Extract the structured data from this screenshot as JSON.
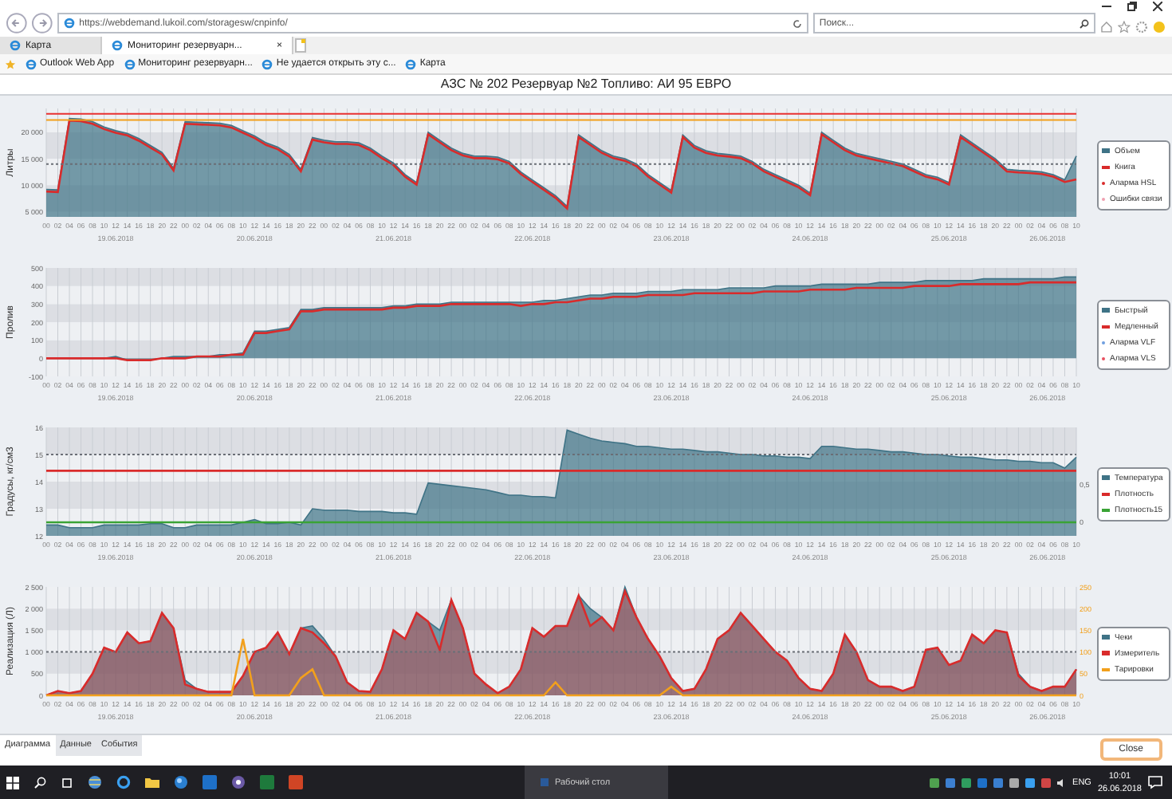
{
  "browser": {
    "address": "https://webdemand.lukoil.com/storagesw/cnpinfo/",
    "search_placeholder": "Поиск...",
    "tabs": [
      {
        "label": "Карта",
        "selected": false
      },
      {
        "label": "Мониторинг резервуарн...",
        "selected": true,
        "close": "×"
      }
    ],
    "favorites": [
      {
        "label": "Outlook Web App"
      },
      {
        "label": "Мониторинг резервуарн..."
      },
      {
        "label": "Не удается открыть эту с..."
      },
      {
        "label": "Карта"
      }
    ]
  },
  "page_title": "АЗС № 202 Резервуар №2 Топливо: АИ 95 ЕВРО",
  "charts": [
    {
      "date_labels": [
        "19.06.2018",
        "20.06.2018",
        "21.06.2018",
        "22.06.2018",
        "23.06.2018",
        "24.06.2018",
        "25.06.2018",
        "26.06.2018"
      ],
      "legend_markers": [
        {
          "label": "Аларма HSL",
          "color": "#d92b2b"
        },
        {
          "label": "Ошибки связи",
          "color": "#f0a0b0"
        }
      ],
      "chart_data": {
        "type": "area",
        "ylabel": "Литры",
        "grid": true,
        "legend": "right",
        "categories": [
          "00",
          "02",
          "04",
          "06",
          "08",
          "10",
          "12",
          "14",
          "16",
          "18",
          "20",
          "22",
          "00",
          "02",
          "04",
          "06",
          "08",
          "10",
          "12",
          "14",
          "16",
          "18",
          "20",
          "22",
          "00",
          "02",
          "04",
          "06",
          "08",
          "10",
          "12",
          "14",
          "16",
          "18",
          "20",
          "22",
          "00",
          "02",
          "04",
          "06",
          "08",
          "10",
          "12",
          "14",
          "16",
          "18",
          "20",
          "22",
          "00",
          "02",
          "04",
          "06",
          "08",
          "10",
          "12",
          "14",
          "16",
          "18",
          "20",
          "22",
          "00",
          "02",
          "04",
          "06",
          "08",
          "10",
          "12",
          "14",
          "16",
          "18",
          "20",
          "22",
          "00",
          "02",
          "04",
          "06",
          "08",
          "10",
          "12",
          "14",
          "16",
          "18",
          "20",
          "22",
          "00",
          "02",
          "04",
          "06",
          "08",
          "10"
        ],
        "ylim": [
          4000,
          24500
        ],
        "yticks": [
          {
            "value": 5000,
            "label": "5 000"
          },
          {
            "value": 10000,
            "label": "10 000"
          },
          {
            "value": 15000,
            "label": "15 000"
          },
          {
            "value": 20000,
            "label": "20 000"
          }
        ],
        "series": [
          {
            "name": "Объем",
            "color": "#3f7386",
            "type": "area",
            "values": [
              9200,
              9100,
              22600,
              22500,
              22000,
              21000,
              20300,
              19800,
              18800,
              17500,
              16200,
              13200,
              22000,
              21900,
              21800,
              21700,
              21300,
              20300,
              19300,
              18000,
              17200,
              15800,
              13000,
              19000,
              18500,
              18200,
              18200,
              18000,
              17000,
              15500,
              14200,
              12000,
              10500,
              20000,
              18500,
              17000,
              16000,
              15500,
              15500,
              15300,
              14500,
              12500,
              11000,
              9500,
              8000,
              6000,
              19500,
              18000,
              16500,
              15500,
              15000,
              14000,
              12000,
              10500,
              9000,
              19500,
              17500,
              16500,
              16000,
              15800,
              15500,
              14500,
              13000,
              12000,
              11000,
              10000,
              8500,
              20000,
              18500,
              17000,
              16000,
              15500,
              15000,
              14500,
              14000,
              13000,
              12000,
              11500,
              10500,
              19500,
              18000,
              16500,
              15000,
              13000,
              12800,
              12700,
              12500,
              12000,
              11000,
              15500
            ]
          },
          {
            "name": "Книга",
            "color": "#d92b2b",
            "type": "line",
            "values": [
              8800,
              8700,
              22200,
              22100,
              21600,
              20600,
              19900,
              19400,
              18400,
              17100,
              15800,
              12800,
              21600,
              21500,
              21400,
              21300,
              20900,
              19900,
              18900,
              17600,
              16800,
              15400,
              12600,
              18600,
              18100,
              17800,
              17800,
              17600,
              16600,
              15100,
              13800,
              11600,
              10100,
              19600,
              18100,
              16600,
              15600,
              15100,
              15100,
              14900,
              14100,
              12100,
              10600,
              9100,
              7600,
              5600,
              19100,
              17600,
              16100,
              15100,
              14600,
              13600,
              11600,
              10100,
              8600,
              19100,
              17100,
              16100,
              15600,
              15400,
              15100,
              14100,
              12600,
              11600,
              10600,
              9600,
              8100,
              19600,
              18100,
              16600,
              15600,
              15100,
              14600,
              14100,
              13600,
              12600,
              11600,
              11100,
              10100,
              19100,
              17600,
              16100,
              14600,
              12600,
              12400,
              12300,
              12100,
              11600,
              10600,
              11100
            ]
          }
        ],
        "ref_lines": [
          {
            "axis": "y",
            "value": 23500,
            "color": "#e83030"
          },
          {
            "axis": "y",
            "value": 22300,
            "color": "#f2a01c"
          },
          {
            "axis": "y",
            "value": 14000
          }
        ]
      }
    },
    {
      "date_labels": [
        "19.06.2018",
        "20.06.2018",
        "21.06.2018",
        "22.06.2018",
        "23.06.2018",
        "24.06.2018",
        "25.06.2018",
        "26.06.2018"
      ],
      "legend_markers": [
        {
          "label": "Аларма VLF",
          "color": "#6f9fe0"
        },
        {
          "label": "Аларма VLS",
          "color": "#e85060"
        }
      ],
      "chart_data": {
        "type": "area",
        "ylabel": "Пролив",
        "grid": true,
        "legend": "right",
        "categories": [
          "00",
          "02",
          "04",
          "06",
          "08",
          "10",
          "12",
          "14",
          "16",
          "18",
          "20",
          "22",
          "00",
          "02",
          "04",
          "06",
          "08",
          "10",
          "12",
          "14",
          "16",
          "18",
          "20",
          "22",
          "00",
          "02",
          "04",
          "06",
          "08",
          "10",
          "12",
          "14",
          "16",
          "18",
          "20",
          "22",
          "00",
          "02",
          "04",
          "06",
          "08",
          "10",
          "12",
          "14",
          "16",
          "18",
          "20",
          "22",
          "00",
          "02",
          "04",
          "06",
          "08",
          "10",
          "12",
          "14",
          "16",
          "18",
          "20",
          "22",
          "00",
          "02",
          "04",
          "06",
          "08",
          "10",
          "12",
          "14",
          "16",
          "18",
          "20",
          "22",
          "00",
          "02",
          "04",
          "06",
          "08",
          "10",
          "12",
          "14",
          "16",
          "18",
          "20",
          "22",
          "00",
          "02",
          "04",
          "06",
          "08",
          "10"
        ],
        "ylim": [
          -100,
          500
        ],
        "yticks": [
          {
            "value": -100,
            "label": "-100"
          },
          {
            "value": 0,
            "label": "0"
          },
          {
            "value": 100,
            "label": "100"
          },
          {
            "value": 200,
            "label": "200"
          },
          {
            "value": 300,
            "label": "300"
          },
          {
            "value": 400,
            "label": "400"
          },
          {
            "value": 500,
            "label": "500"
          }
        ],
        "series": [
          {
            "name": "Быстрый",
            "color": "#3f7386",
            "type": "area",
            "values": [
              0,
              0,
              0,
              0,
              0,
              0,
              10,
              -10,
              -10,
              -10,
              0,
              10,
              10,
              10,
              10,
              20,
              20,
              30,
              150,
              150,
              160,
              170,
              270,
              270,
              280,
              280,
              280,
              280,
              280,
              280,
              290,
              290,
              300,
              300,
              300,
              310,
              310,
              310,
              310,
              310,
              310,
              310,
              310,
              320,
              320,
              330,
              340,
              350,
              350,
              360,
              360,
              360,
              370,
              370,
              370,
              380,
              380,
              380,
              380,
              390,
              390,
              390,
              390,
              400,
              400,
              400,
              400,
              410,
              410,
              410,
              410,
              410,
              420,
              420,
              420,
              420,
              430,
              430,
              430,
              430,
              430,
              440,
              440,
              440,
              440,
              440,
              440,
              440,
              450,
              450
            ]
          },
          {
            "name": "Медленный",
            "color": "#d92b2b",
            "type": "line",
            "values": [
              0,
              0,
              0,
              0,
              0,
              0,
              0,
              -10,
              -10,
              -10,
              0,
              0,
              0,
              10,
              10,
              10,
              20,
              20,
              140,
              140,
              150,
              160,
              260,
              260,
              270,
              270,
              270,
              270,
              270,
              270,
              280,
              280,
              290,
              290,
              290,
              300,
              300,
              300,
              300,
              300,
              300,
              290,
              300,
              300,
              310,
              310,
              320,
              330,
              330,
              340,
              340,
              340,
              350,
              350,
              350,
              350,
              360,
              360,
              360,
              360,
              360,
              360,
              370,
              370,
              370,
              370,
              380,
              380,
              380,
              380,
              390,
              390,
              390,
              390,
              390,
              400,
              400,
              400,
              400,
              410,
              410,
              410,
              410,
              410,
              410,
              420,
              420,
              420,
              420,
              420
            ]
          }
        ]
      }
    },
    {
      "date_labels": [
        "19.06.2018",
        "20.06.2018",
        "21.06.2018",
        "22.06.2018",
        "23.06.2018",
        "24.06.2018",
        "25.06.2018",
        "26.06.2018"
      ],
      "chart_data": {
        "type": "area",
        "ylabel": "Градусы, кг/см3",
        "grid": true,
        "legend": "right",
        "categories": [
          "00",
          "02",
          "04",
          "06",
          "08",
          "10",
          "12",
          "14",
          "16",
          "18",
          "20",
          "22",
          "00",
          "02",
          "04",
          "06",
          "08",
          "10",
          "12",
          "14",
          "16",
          "18",
          "20",
          "22",
          "00",
          "02",
          "04",
          "06",
          "08",
          "10",
          "12",
          "14",
          "16",
          "18",
          "20",
          "22",
          "00",
          "02",
          "04",
          "06",
          "08",
          "10",
          "12",
          "14",
          "16",
          "18",
          "20",
          "22",
          "00",
          "02",
          "04",
          "06",
          "08",
          "10",
          "12",
          "14",
          "16",
          "18",
          "20",
          "22",
          "00",
          "02",
          "04",
          "06",
          "08",
          "10",
          "12",
          "14",
          "16",
          "18",
          "20",
          "22",
          "00",
          "02",
          "04",
          "06",
          "08",
          "10",
          "12",
          "14",
          "16",
          "18",
          "20",
          "22",
          "00",
          "02",
          "04",
          "06",
          "08",
          "10"
        ],
        "ylim": [
          12,
          16
        ],
        "yticks": [
          {
            "value": 12,
            "label": "12"
          },
          {
            "value": 13,
            "label": "13"
          },
          {
            "value": 14,
            "label": "14"
          },
          {
            "value": 15,
            "label": "15"
          },
          {
            "value": 16,
            "label": "16"
          }
        ],
        "y2lim": [
          -0.18,
          1.25
        ],
        "y2ticks": [
          {
            "value": 0,
            "label": "0"
          },
          {
            "value": 0.5,
            "label": "0,5"
          }
        ],
        "series": [
          {
            "name": "Температура",
            "color": "#3f7386",
            "type": "area",
            "values": [
              12.4,
              12.4,
              12.3,
              12.3,
              12.3,
              12.4,
              12.4,
              12.4,
              12.4,
              12.45,
              12.45,
              12.3,
              12.3,
              12.4,
              12.4,
              12.4,
              12.4,
              12.5,
              12.6,
              12.45,
              12.45,
              12.5,
              12.4,
              13.0,
              12.95,
              12.95,
              12.95,
              12.9,
              12.9,
              12.9,
              12.85,
              12.85,
              12.8,
              13.95,
              13.9,
              13.85,
              13.8,
              13.75,
              13.7,
              13.6,
              13.5,
              13.5,
              13.45,
              13.45,
              13.4,
              15.9,
              15.75,
              15.6,
              15.5,
              15.45,
              15.4,
              15.3,
              15.3,
              15.25,
              15.2,
              15.2,
              15.15,
              15.1,
              15.1,
              15.05,
              15.0,
              15.0,
              14.95,
              14.95,
              14.9,
              14.9,
              14.85,
              15.3,
              15.3,
              15.25,
              15.2,
              15.2,
              15.15,
              15.1,
              15.1,
              15.05,
              15.0,
              15.0,
              14.95,
              14.9,
              14.9,
              14.85,
              14.8,
              14.8,
              14.75,
              14.75,
              14.7,
              14.7,
              14.5,
              14.9
            ]
          },
          {
            "name": "Плотность",
            "color": "#d92b2b",
            "type": "line",
            "values": [
              14.4,
              14.4,
              14.4,
              14.4,
              14.4,
              14.4,
              14.4,
              14.4,
              14.4,
              14.4,
              14.4,
              14.4,
              14.4,
              14.4,
              14.4,
              14.4,
              14.4,
              14.4,
              14.4,
              14.4,
              14.4,
              14.4,
              14.4,
              14.4,
              14.4,
              14.4,
              14.4,
              14.4,
              14.4,
              14.4,
              14.4,
              14.4,
              14.4,
              14.4,
              14.4,
              14.4,
              14.4,
              14.4,
              14.4,
              14.4,
              14.4,
              14.4,
              14.4,
              14.4,
              14.4,
              14.4,
              14.4,
              14.4,
              14.4,
              14.4,
              14.4,
              14.4,
              14.4,
              14.4,
              14.4,
              14.4,
              14.4,
              14.4,
              14.4,
              14.4,
              14.4,
              14.4,
              14.4,
              14.4,
              14.4,
              14.4,
              14.4,
              14.4,
              14.4,
              14.4,
              14.4,
              14.4,
              14.4,
              14.4,
              14.4,
              14.4,
              14.4,
              14.4,
              14.4,
              14.4,
              14.4,
              14.4,
              14.4,
              14.4,
              14.4,
              14.4,
              14.4,
              14.4,
              14.4,
              14.4
            ]
          },
          {
            "name": "Плотность15",
            "color": "#3aa335",
            "type": "line",
            "values": [
              12.5,
              12.5,
              12.5,
              12.5,
              12.5,
              12.5,
              12.5,
              12.5,
              12.5,
              12.5,
              12.5,
              12.5,
              12.5,
              12.5,
              12.5,
              12.5,
              12.5,
              12.5,
              12.5,
              12.5,
              12.5,
              12.5,
              12.5,
              12.5,
              12.5,
              12.5,
              12.5,
              12.5,
              12.5,
              12.5,
              12.5,
              12.5,
              12.5,
              12.5,
              12.5,
              12.5,
              12.5,
              12.5,
              12.5,
              12.5,
              12.5,
              12.5,
              12.5,
              12.5,
              12.5,
              12.5,
              12.5,
              12.5,
              12.5,
              12.5,
              12.5,
              12.5,
              12.5,
              12.5,
              12.5,
              12.5,
              12.5,
              12.5,
              12.5,
              12.5,
              12.5,
              12.5,
              12.5,
              12.5,
              12.5,
              12.5,
              12.5,
              12.5,
              12.5,
              12.5,
              12.5,
              12.5,
              12.5,
              12.5,
              12.5,
              12.5,
              12.5,
              12.5,
              12.5,
              12.5,
              12.5,
              12.5,
              12.5,
              12.5,
              12.5,
              12.5,
              12.5,
              12.5,
              12.5,
              12.5
            ]
          }
        ],
        "ref_lines": [
          {
            "axis": "y",
            "value": 15
          }
        ]
      }
    },
    {
      "date_labels": [
        "19.06.2018",
        "20.06.2018",
        "21.06.2018",
        "22.06.2018",
        "23.06.2018",
        "24.06.2018",
        "25.06.2018",
        "26.06.2018"
      ],
      "chart_data": {
        "type": "area",
        "ylabel": "Реализация (Л)",
        "grid": true,
        "legend": "right",
        "categories": [
          "00",
          "02",
          "04",
          "06",
          "08",
          "10",
          "12",
          "14",
          "16",
          "18",
          "20",
          "22",
          "00",
          "02",
          "04",
          "06",
          "08",
          "10",
          "12",
          "14",
          "16",
          "18",
          "20",
          "22",
          "00",
          "02",
          "04",
          "06",
          "08",
          "10",
          "12",
          "14",
          "16",
          "18",
          "20",
          "22",
          "00",
          "02",
          "04",
          "06",
          "08",
          "10",
          "12",
          "14",
          "16",
          "18",
          "20",
          "22",
          "00",
          "02",
          "04",
          "06",
          "08",
          "10",
          "12",
          "14",
          "16",
          "18",
          "20",
          "22",
          "00",
          "02",
          "04",
          "06",
          "08",
          "10",
          "12",
          "14",
          "16",
          "18",
          "20",
          "22",
          "00",
          "02",
          "04",
          "06",
          "08",
          "10",
          "12",
          "14",
          "16",
          "18",
          "20",
          "22",
          "00",
          "02",
          "04",
          "06",
          "08",
          "10"
        ],
        "ylim": [
          0,
          2500
        ],
        "yticks": [
          {
            "value": 0,
            "label": "0"
          },
          {
            "value": 500,
            "label": "500"
          },
          {
            "value": 1000,
            "label": "1 000"
          },
          {
            "value": 1500,
            "label": "1 500"
          },
          {
            "value": 2000,
            "label": "2 000"
          },
          {
            "value": 2500,
            "label": "2 500"
          }
        ],
        "y2lim": [
          0,
          250
        ],
        "y2ticks": [
          {
            "value": 0,
            "label": "0"
          },
          {
            "value": 50,
            "label": "50"
          },
          {
            "value": 100,
            "label": "100"
          },
          {
            "value": 150,
            "label": "150"
          },
          {
            "value": 200,
            "label": "200"
          },
          {
            "value": 250,
            "label": "250"
          }
        ],
        "series": [
          {
            "name": "Чеки",
            "color": "#3f7386",
            "type": "area",
            "values": [
              0,
              100,
              50,
              100,
              500,
              1100,
              1000,
              1450,
              1200,
              1250,
              1900,
              1550,
              350,
              150,
              80,
              80,
              80,
              450,
              1000,
              1100,
              1450,
              950,
              1550,
              1600,
              1300,
              900,
              300,
              100,
              80,
              600,
              1500,
              1300,
              1900,
              1700,
              1500,
              2200,
              1550,
              500,
              250,
              50,
              200,
              600,
              1550,
              1350,
              1600,
              1600,
              2300,
              2000,
              1800,
              1500,
              2500,
              1800,
              1300,
              900,
              400,
              100,
              150,
              600,
              1300,
              1500,
              1900,
              1600,
              1300,
              1000,
              800,
              400,
              150,
              100,
              500,
              1400,
              1000,
              350,
              200,
              200,
              100,
              200,
              1050,
              1100,
              700,
              800,
              1400,
              1200,
              1500,
              1450,
              500,
              200,
              100,
              200,
              200,
              600
            ]
          },
          {
            "name": "Измеритель",
            "color": "#d92b2b",
            "type": "area",
            "values": [
              0,
              100,
              50,
              100,
              500,
              1100,
              1000,
              1450,
              1200,
              1250,
              1900,
              1550,
              250,
              150,
              80,
              80,
              80,
              450,
              1000,
              1100,
              1450,
              950,
              1550,
              1450,
              1200,
              900,
              300,
              100,
              80,
              600,
              1500,
              1300,
              1900,
              1700,
              1050,
              2200,
              1550,
              500,
              250,
              50,
              200,
              600,
              1550,
              1350,
              1600,
              1600,
              2300,
              1600,
              1800,
              1500,
              2400,
              1800,
              1300,
              900,
              400,
              100,
              150,
              600,
              1300,
              1500,
              1900,
              1600,
              1300,
              1000,
              800,
              400,
              150,
              100,
              500,
              1400,
              1000,
              350,
              200,
              200,
              100,
              200,
              1050,
              1100,
              700,
              800,
              1400,
              1200,
              1500,
              1450,
              450,
              200,
              100,
              200,
              200,
              600
            ]
          },
          {
            "name": "Тарировки",
            "color": "#f2a01c",
            "type": "line",
            "axis": "y2",
            "values": [
              0,
              0,
              0,
              0,
              0,
              0,
              0,
              0,
              0,
              0,
              0,
              0,
              0,
              0,
              0,
              0,
              0,
              130,
              0,
              0,
              0,
              0,
              40,
              60,
              0,
              0,
              0,
              0,
              0,
              0,
              0,
              0,
              0,
              0,
              0,
              0,
              0,
              0,
              0,
              0,
              0,
              0,
              0,
              0,
              30,
              0,
              0,
              0,
              0,
              0,
              0,
              0,
              0,
              0,
              20,
              0,
              0,
              0,
              0,
              0,
              0,
              0,
              0,
              0,
              0,
              0,
              0,
              0,
              0,
              0,
              0,
              0,
              0,
              0,
              0,
              0,
              0,
              0,
              0,
              0,
              0,
              0,
              0,
              0,
              0,
              0,
              0,
              0,
              0,
              0
            ]
          }
        ],
        "ref_lines": [
          {
            "axis": "y",
            "value": 1000
          }
        ]
      }
    }
  ],
  "bottom_tabs": [
    {
      "label": "Диаграмма",
      "selected": true
    },
    {
      "label": "Данные",
      "selected": false
    },
    {
      "label": "События",
      "selected": false
    }
  ],
  "close_button": "Close",
  "taskbar": {
    "window_item": "Рабочий стол",
    "language": "ENG",
    "time": "10:01",
    "date": "26.06.2018"
  }
}
